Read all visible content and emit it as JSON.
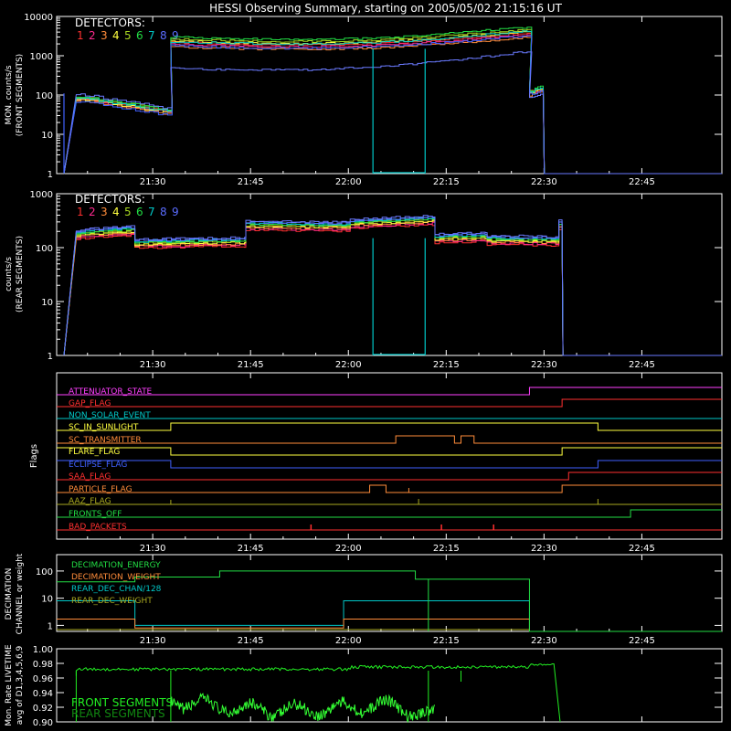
{
  "title": "HESSI Observing Summary, starting on 2005/05/02 21:15:16 UT",
  "time_ticks": [
    "21:30",
    "21:45",
    "22:00",
    "22:15",
    "22:30",
    "22:45"
  ],
  "detectors_label": "DETECTORS:",
  "detector_numbers": [
    "1",
    "2",
    "3",
    "4",
    "5",
    "6",
    "7",
    "8",
    "9"
  ],
  "detector_colors": [
    "#ff3030",
    "#ff2a90",
    "#ff8c3a",
    "#ffff40",
    "#a8d820",
    "#22dd44",
    "#00c8c8",
    "#5a6cff",
    "#5a6cff"
  ],
  "chart_data": [
    {
      "type": "line",
      "ylabel": "MON. counts/s (FRONT SEGMENTS)",
      "yscale": "log",
      "ylim": [
        1,
        10000
      ],
      "ytick_labels": [
        "1",
        "10",
        "100",
        "1000",
        "10000"
      ],
      "xlim": [
        "21:15:16",
        "22:57"
      ],
      "series": [
        {
          "name": "1",
          "color": "#ff3030",
          "x": [
            "21:18",
            "21:32",
            "21:32",
            "22:27",
            "22:27",
            "22:29",
            "22:29"
          ],
          "y": [
            85,
            38,
            2200,
            3800,
            120,
            140,
            1
          ]
        },
        {
          "name": "2",
          "color": "#ff2a90",
          "x": [
            "21:18",
            "21:32",
            "21:32",
            "22:27",
            "22:27",
            "22:29",
            "22:29"
          ],
          "y": [
            80,
            35,
            2000,
            3500,
            110,
            135,
            1
          ]
        },
        {
          "name": "3",
          "color": "#ff8c3a",
          "x": [
            "21:18",
            "21:32",
            "21:32",
            "22:27",
            "22:27",
            "22:29",
            "22:29"
          ],
          "y": [
            75,
            32,
            1700,
            3000,
            100,
            125,
            1
          ]
        },
        {
          "name": "4",
          "color": "#ffff40",
          "x": [
            "21:18",
            "21:32",
            "21:32",
            "22:27",
            "22:27",
            "22:29",
            "22:29"
          ],
          "y": [
            82,
            36,
            2400,
            4200,
            115,
            150,
            1
          ]
        },
        {
          "name": "5",
          "color": "#a8d820",
          "x": [
            "21:18",
            "21:32",
            "21:32",
            "22:27",
            "22:27",
            "22:29",
            "22:29"
          ],
          "y": [
            90,
            40,
            2700,
            4800,
            125,
            155,
            1
          ]
        },
        {
          "name": "6",
          "color": "#22dd44",
          "x": [
            "21:18",
            "21:32",
            "21:32",
            "22:27",
            "22:27",
            "22:29",
            "22:29"
          ],
          "y": [
            95,
            42,
            3000,
            5500,
            130,
            165,
            1
          ]
        },
        {
          "name": "7",
          "color": "#00c8c8",
          "x": [
            "21:18",
            "21:32",
            "21:32",
            "22:27",
            "22:27",
            "22:29",
            "22:29"
          ],
          "y": [
            88,
            38,
            2300,
            4300,
            120,
            150,
            1
          ]
        },
        {
          "name": "8",
          "color": "#4060ff",
          "x": [
            "21:18",
            "21:32",
            "21:32",
            "22:27",
            "22:27",
            "22:29",
            "22:29"
          ],
          "y": [
            70,
            30,
            1800,
            3300,
            105,
            130,
            1
          ]
        },
        {
          "name": "9",
          "color": "#6a7aff",
          "x": [
            "21:18",
            "21:32",
            "21:32",
            "22:27",
            "22:27",
            "22:29",
            "22:29"
          ],
          "y": [
            110,
            45,
            480,
            1300,
            90,
            110,
            1
          ]
        }
      ]
    },
    {
      "type": "line",
      "ylabel": "counts/s (REAR SEGMENTS)",
      "yscale": "log",
      "ylim": [
        1,
        1000
      ],
      "ytick_labels": [
        "1",
        "10",
        "100",
        "1000"
      ],
      "xlim": [
        "21:15:16",
        "22:57"
      ],
      "series": [
        {
          "name": "1",
          "color": "#ff3030",
          "y_levels": [
            190,
            130,
            260,
            260,
            330,
            150,
            140,
            130,
            290,
            270
          ]
        },
        {
          "name": "6",
          "color": "#22dd44",
          "y_levels": [
            220,
            150,
            300,
            290,
            360,
            170,
            160,
            150,
            320,
            300
          ]
        },
        {
          "name": "7",
          "color": "#00c8c8",
          "y_levels": [
            200,
            140,
            270,
            270,
            340,
            160,
            150,
            140,
            300,
            280
          ]
        },
        {
          "name": "9",
          "color": "#5a6cff",
          "y_levels": [
            170,
            120,
            240,
            240,
            300,
            140,
            130,
            120,
            270,
            250
          ]
        }
      ]
    },
    {
      "type": "line",
      "ylabel": "Flags",
      "flags": [
        {
          "name": "ATTENUATOR_STATE",
          "color": "#ff40ff"
        },
        {
          "name": "GAP_FLAG",
          "color": "#ff3030"
        },
        {
          "name": "NON_SOLAR_EVENT",
          "color": "#00c8c8"
        },
        {
          "name": "SC_IN_SUNLIGHT",
          "color": "#ffff40"
        },
        {
          "name": "SC_TRANSMITTER",
          "color": "#ff8c3a"
        },
        {
          "name": "FLARE_FLAG",
          "color": "#ffff40"
        },
        {
          "name": "ECLIPSE_FLAG",
          "color": "#4060ff"
        },
        {
          "name": "SAA_FLAG",
          "color": "#ff3030"
        },
        {
          "name": "PARTICLE_FLAG",
          "color": "#ff8c3a"
        },
        {
          "name": "AAZ_FLAG",
          "color": "#a8a820"
        },
        {
          "name": "FRONTS_OFF",
          "color": "#22dd44"
        },
        {
          "name": "BAD_PACKETS",
          "color": "#ff3030"
        }
      ]
    },
    {
      "type": "line",
      "ylabel": "DECIMATION CHANNEL or weight",
      "yscale": "log",
      "ytick_labels": [
        "1",
        "10",
        "100"
      ],
      "series": [
        {
          "name": "DECIMATION_ENERGY",
          "color": "#22dd44"
        },
        {
          "name": "DECIMATION_WEIGHT",
          "color": "#ff8c3a"
        },
        {
          "name": "REAR_DEC_CHAN/128",
          "color": "#00c8c8"
        },
        {
          "name": "REAR_DEC_WEIGHT",
          "color": "#a8a820"
        }
      ]
    },
    {
      "type": "line",
      "ylabel": "Mon. Rate LIVETIME avg of D1,3,4,5,6,9",
      "ylim": [
        0.9,
        1.0
      ],
      "ytick_labels": [
        "0.90",
        "0.92",
        "0.94",
        "0.96",
        "0.98",
        "1.00"
      ],
      "series": [
        {
          "name": "FRONT SEGMENTS",
          "color": "#22ee22"
        },
        {
          "name": "REAR SEGMENTS",
          "color": "#118811"
        }
      ]
    }
  ]
}
